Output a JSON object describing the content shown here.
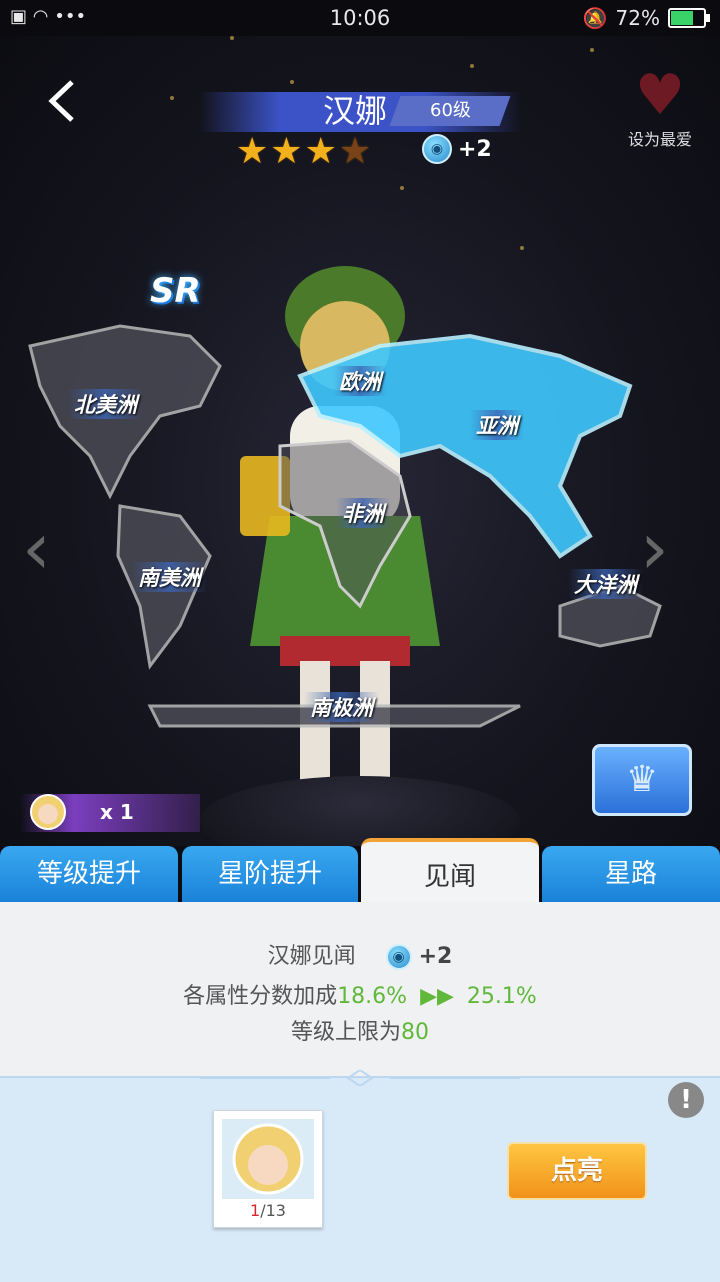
{
  "status_bar": {
    "time": "10:06",
    "left_icons": [
      "notification-icon",
      "wifi-icon",
      "more-dots-icon"
    ],
    "left_text": "… •••",
    "battery_percent": "72%",
    "battery_level": 0.72
  },
  "hero": {
    "name": "汉娜",
    "level": "60级",
    "stars_total": 4,
    "stars_filled": 3,
    "insight_bonus": "+2",
    "rarity": "SR",
    "favorite_label": "设为最爱",
    "shard_count": "x 1"
  },
  "map": {
    "continents": [
      "北美洲",
      "欧洲",
      "亚洲",
      "非洲",
      "南美洲",
      "大洋洲",
      "南极洲"
    ],
    "active_continent": "亚洲",
    "highlight_color": "#3fc8ff"
  },
  "tabs": [
    {
      "label": "等级提升",
      "active": false
    },
    {
      "label": "星阶提升",
      "active": false
    },
    {
      "label": "见闻",
      "active": true
    },
    {
      "label": "星路",
      "active": false
    }
  ],
  "insight_panel": {
    "title": "汉娜见闻",
    "bonus": "+2",
    "attr_label": "各属性分数加成",
    "attr_from": "18.6%",
    "attr_to": "25.1%",
    "level_cap_label": "等级上限为",
    "level_cap_value": "80"
  },
  "unlock": {
    "progress_current": "1",
    "progress_total": "/13",
    "button_label": "点亮"
  },
  "colors": {
    "tab_blue": "#1a82d8",
    "accent_orange": "#f1921a",
    "green": "#5fb83a",
    "panel_bg": "#f0f1f3"
  }
}
